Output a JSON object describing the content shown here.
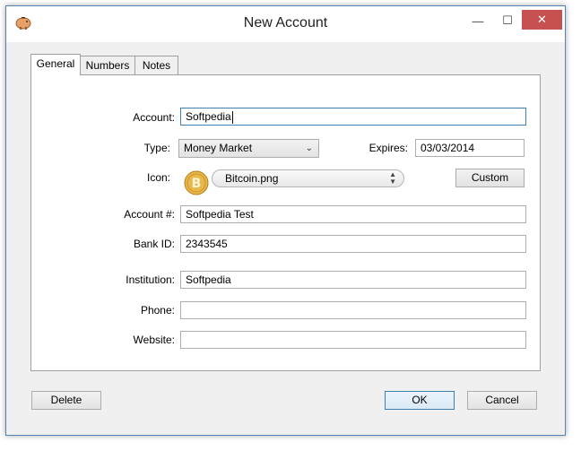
{
  "window": {
    "title": "New Account",
    "controls": {
      "minimize": "—",
      "maximize": "☐",
      "close": "✕"
    }
  },
  "tabs": [
    {
      "label": "General",
      "active": true
    },
    {
      "label": "Numbers",
      "active": false
    },
    {
      "label": "Notes",
      "active": false
    }
  ],
  "form": {
    "account_label": "Account:",
    "account_value": "Softpedia",
    "type_label": "Type:",
    "type_value": "Money Market",
    "expires_label": "Expires:",
    "expires_value": "03/03/2014",
    "icon_label": "Icon:",
    "icon_value": "Bitcoin.png",
    "custom_button": "Custom",
    "account_number_label": "Account #:",
    "account_number_value": "Softpedia Test",
    "bank_id_label": "Bank ID:",
    "bank_id_value": "2343545",
    "institution_label": "Institution:",
    "institution_value": "Softpedia",
    "phone_label": "Phone:",
    "phone_value": "",
    "website_label": "Website:",
    "website_value": ""
  },
  "footer": {
    "delete_button": "Delete",
    "ok_button": "OK",
    "cancel_button": "Cancel"
  },
  "colors": {
    "accent": "#3c7fb1",
    "close_button": "#c75050",
    "coin_gold": "#e8b84a"
  },
  "icons": {
    "app": "piggy-bank-icon",
    "account_icon": "bitcoin-icon"
  }
}
